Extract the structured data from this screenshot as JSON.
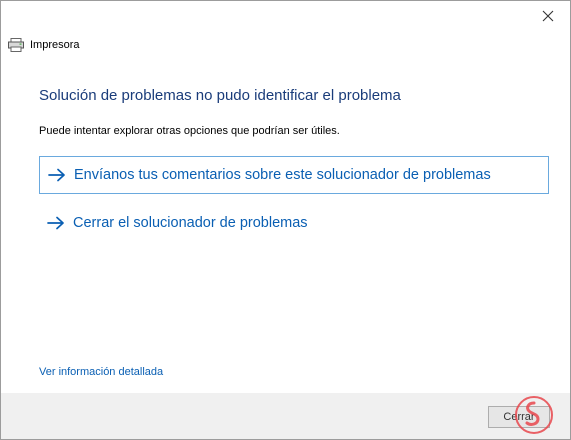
{
  "window": {
    "title": "Impresora",
    "close_icon": "close-icon",
    "app_icon": "printer-icon"
  },
  "main": {
    "heading": "Solución de problemas no pudo identificar el problema",
    "subtext": "Puede intentar explorar otras opciones que podrían ser útiles.",
    "options": [
      {
        "label": "Envíanos tus comentarios sobre este solucionador de problemas",
        "icon": "arrow-right-icon",
        "focused": true
      },
      {
        "label": "Cerrar el solucionador de problemas",
        "icon": "arrow-right-icon",
        "focused": false
      }
    ],
    "details_link": "Ver información detallada"
  },
  "footer": {
    "close_button": "Cerrar"
  },
  "colors": {
    "heading": "#1a3c7a",
    "link": "#0a5fb3",
    "focus_border": "#6aa9de",
    "footer_bg": "#f0f0f0",
    "watermark": "#e8474c"
  }
}
